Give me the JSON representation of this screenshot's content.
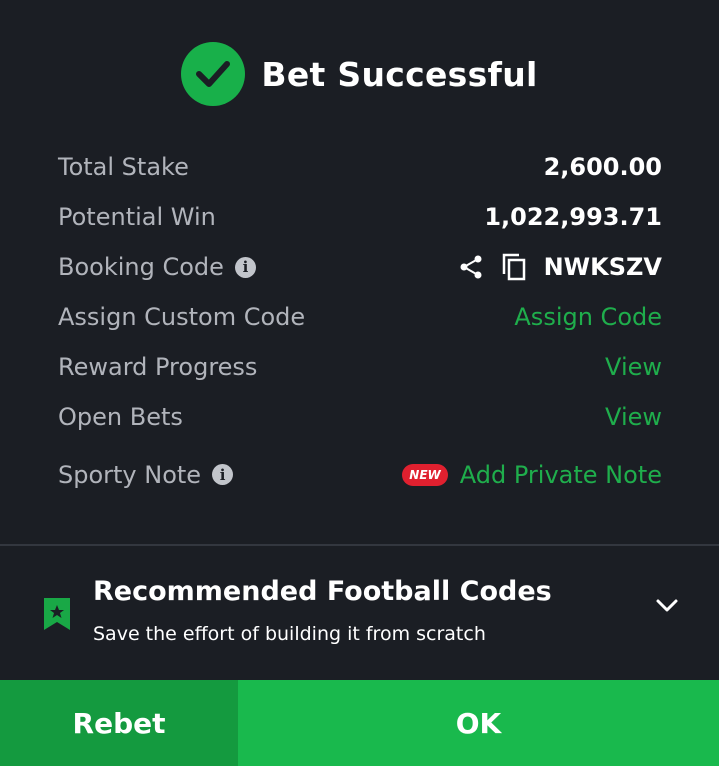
{
  "header": {
    "title": "Bet Successful"
  },
  "rows": {
    "total_stake": {
      "label": "Total Stake",
      "value": "2,600.00"
    },
    "potential_win": {
      "label": "Potential Win",
      "value": "1,022,993.71"
    },
    "booking_code": {
      "label": "Booking Code",
      "value": "NWKSZV"
    },
    "assign_custom_code": {
      "label": "Assign Custom Code",
      "link": "Assign Code"
    },
    "reward_progress": {
      "label": "Reward Progress",
      "link": "View"
    },
    "open_bets": {
      "label": "Open Bets",
      "link": "View"
    },
    "sporty_note": {
      "label": "Sporty Note",
      "badge": "NEW",
      "link": "Add Private Note"
    }
  },
  "recommended": {
    "title": "Recommended Football Codes",
    "subtitle": "Save the effort of building it from scratch"
  },
  "buttons": {
    "rebet": "Rebet",
    "ok": "OK"
  },
  "colors": {
    "accent": "#1fae4c",
    "background": "#1b1e24",
    "badge": "#e0202f"
  }
}
